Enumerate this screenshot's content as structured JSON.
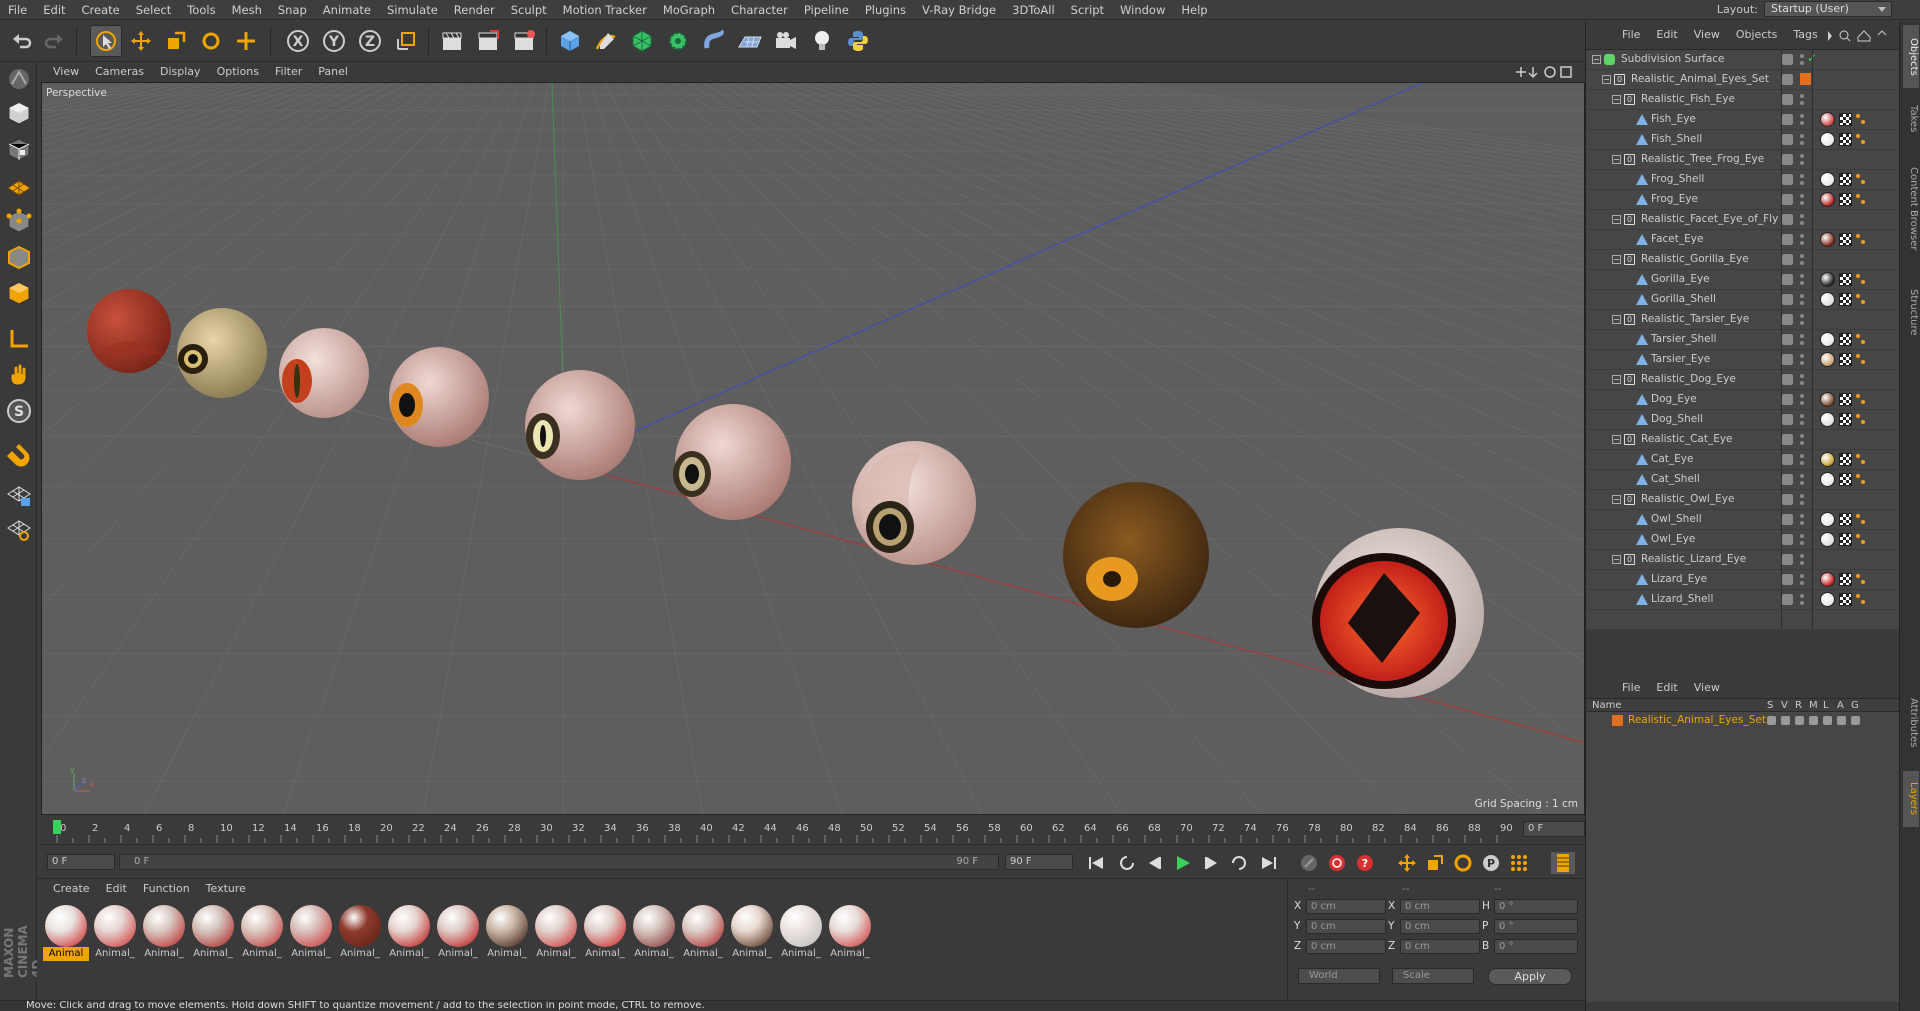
{
  "menubar": {
    "items": [
      "File",
      "Edit",
      "Create",
      "Select",
      "Tools",
      "Mesh",
      "Snap",
      "Animate",
      "Simulate",
      "Render",
      "Sculpt",
      "Motion Tracker",
      "MoGraph",
      "Character",
      "Pipeline",
      "Plugins",
      "V-Ray Bridge",
      "3DToAll",
      "Script",
      "Window",
      "Help"
    ],
    "layout_label": "Layout:",
    "layout_value": "Startup (User)"
  },
  "viewport": {
    "menu": [
      "View",
      "Cameras",
      "Display",
      "Options",
      "Filter",
      "Panel"
    ],
    "label": "Perspective",
    "grid_spacing": "Grid Spacing : 1 cm"
  },
  "timeline": {
    "ticks": [
      "0",
      "2",
      "4",
      "6",
      "8",
      "10",
      "12",
      "14",
      "16",
      "18",
      "20",
      "22",
      "24",
      "26",
      "28",
      "30",
      "32",
      "34",
      "36",
      "38",
      "40",
      "42",
      "44",
      "46",
      "48",
      "50",
      "52",
      "54",
      "56",
      "58",
      "60",
      "62",
      "64",
      "66",
      "68",
      "70",
      "72",
      "74",
      "76",
      "78",
      "80",
      "82",
      "84",
      "86",
      "88",
      "90"
    ],
    "current_frame": "0 F"
  },
  "transport": {
    "start_frame": "0 F",
    "slider_start": "0 F",
    "slider_end": "90 F",
    "end_frame": "90 F"
  },
  "materials": {
    "menu": [
      "Create",
      "Edit",
      "Function",
      "Texture"
    ],
    "items": [
      {
        "label": "Animal",
        "color": "#e9e3e0",
        "accent": "#c22"
      },
      {
        "label": "Animal_",
        "color": "#e6d6d2",
        "accent": "#c33"
      },
      {
        "label": "Animal_",
        "color": "#d8c8c0",
        "accent": "#b22"
      },
      {
        "label": "Animal_",
        "color": "#d5c5bd",
        "accent": "#a22"
      },
      {
        "label": "Animal_",
        "color": "#dcc8c0",
        "accent": "#b33"
      },
      {
        "label": "Animal_",
        "color": "#d9c1bc",
        "accent": "#c33"
      },
      {
        "label": "Animal_",
        "color": "#8e3a2a",
        "accent": "#5c2014"
      },
      {
        "label": "Animal_",
        "color": "#e5d5cf",
        "accent": "#b11"
      },
      {
        "label": "Animal_",
        "color": "#dfcdc8",
        "accent": "#b11"
      },
      {
        "label": "Animal_",
        "color": "#ccb8a8",
        "accent": "#3a1a10"
      },
      {
        "label": "Animal_",
        "color": "#e1d2cc",
        "accent": "#c33"
      },
      {
        "label": "Animal_",
        "color": "#e0d1cb",
        "accent": "#c22"
      },
      {
        "label": "Animal_",
        "color": "#d6c6c0",
        "accent": "#833"
      },
      {
        "label": "Animal_",
        "color": "#dcccc6",
        "accent": "#a22"
      },
      {
        "label": "Animal_",
        "color": "#e8d8d0",
        "accent": "#4a2510"
      },
      {
        "label": "Animal_",
        "color": "#ece4e0",
        "accent": "#bbb"
      },
      {
        "label": "Animal_",
        "color": "#e7ddd8",
        "accent": "#c33"
      }
    ]
  },
  "coordinates": {
    "header_pos": "--",
    "header_size": "--",
    "header_rot": "--",
    "rows": [
      {
        "pos_label": "X",
        "pos_value": "0 cm",
        "size_label": "X",
        "size_value": "0 cm",
        "rot_label": "H",
        "rot_value": "0 °"
      },
      {
        "pos_label": "Y",
        "pos_value": "0 cm",
        "size_label": "Y",
        "size_value": "0 cm",
        "rot_label": "P",
        "rot_value": "0 °"
      },
      {
        "pos_label": "Z",
        "pos_value": "0 cm",
        "size_label": "Z",
        "size_value": "0 cm",
        "rot_label": "B",
        "rot_value": "0 °"
      }
    ],
    "mode_world": "World",
    "mode_scale": "Scale",
    "apply": "Apply"
  },
  "status": "Move: Click and drag to move elements. Hold down SHIFT to quantize movement / add to the selection in point mode, CTRL to remove.",
  "objects": {
    "menu": [
      "File",
      "Edit",
      "View",
      "Objects",
      "Tags"
    ],
    "items": [
      {
        "name": "Subdivision Surface",
        "depth": 0,
        "kind": "subd"
      },
      {
        "name": "Realistic_Animal_Eyes_Set",
        "depth": 1,
        "kind": "null"
      },
      {
        "name": "Realistic_Fish_Eye",
        "depth": 2,
        "kind": "null"
      },
      {
        "name": "Fish_Eye",
        "depth": 3,
        "kind": "poly",
        "tagcolor": "#c44"
      },
      {
        "name": "Fish_Shell",
        "depth": 3,
        "kind": "poly",
        "tagcolor": "#e8e8e8"
      },
      {
        "name": "Realistic_Tree_Frog_Eye",
        "depth": 2,
        "kind": "null"
      },
      {
        "name": "Frog_Shell",
        "depth": 3,
        "kind": "poly",
        "tagcolor": "#e8e8e8"
      },
      {
        "name": "Frog_Eye",
        "depth": 3,
        "kind": "poly",
        "tagcolor": "#b22"
      },
      {
        "name": "Realistic_Facet_Eye_of_Fly",
        "depth": 2,
        "kind": "null"
      },
      {
        "name": "Facet_Eye",
        "depth": 3,
        "kind": "poly",
        "tagcolor": "#8a2a1a"
      },
      {
        "name": "Realistic_Gorilla_Eye",
        "depth": 2,
        "kind": "null"
      },
      {
        "name": "Gorilla_Eye",
        "depth": 3,
        "kind": "poly",
        "tagcolor": "#222"
      },
      {
        "name": "Gorilla_Shell",
        "depth": 3,
        "kind": "poly",
        "tagcolor": "#ddd"
      },
      {
        "name": "Realistic_Tarsier_Eye",
        "depth": 2,
        "kind": "null"
      },
      {
        "name": "Tarsier_Shell",
        "depth": 3,
        "kind": "poly",
        "tagcolor": "#e8e8e8"
      },
      {
        "name": "Tarsier_Eye",
        "depth": 3,
        "kind": "poly",
        "tagcolor": "#c9a070"
      },
      {
        "name": "Realistic_Dog_Eye",
        "depth": 2,
        "kind": "null"
      },
      {
        "name": "Dog_Eye",
        "depth": 3,
        "kind": "poly",
        "tagcolor": "#7a4a2a"
      },
      {
        "name": "Dog_Shell",
        "depth": 3,
        "kind": "poly",
        "tagcolor": "#e0e0e0"
      },
      {
        "name": "Realistic_Cat_Eye",
        "depth": 2,
        "kind": "null"
      },
      {
        "name": "Cat_Eye",
        "depth": 3,
        "kind": "poly",
        "tagcolor": "#c9a030"
      },
      {
        "name": "Cat_Shell",
        "depth": 3,
        "kind": "poly",
        "tagcolor": "#e8e8e8"
      },
      {
        "name": "Realistic_Owl_Eye",
        "depth": 2,
        "kind": "null"
      },
      {
        "name": "Owl_Shell",
        "depth": 3,
        "kind": "poly",
        "tagcolor": "#e8e8e8"
      },
      {
        "name": "Owl_Eye",
        "depth": 3,
        "kind": "poly",
        "tagcolor": "#ddd"
      },
      {
        "name": "Realistic_Lizard_Eye",
        "depth": 2,
        "kind": "null"
      },
      {
        "name": "Lizard_Eye",
        "depth": 3,
        "kind": "poly",
        "tagcolor": "#c22"
      },
      {
        "name": "Lizard_Shell",
        "depth": 3,
        "kind": "poly",
        "tagcolor": "#e8e8e8"
      }
    ]
  },
  "layers": {
    "menu": [
      "File",
      "Edit",
      "View"
    ],
    "columns": [
      "Name",
      "S",
      "V",
      "R",
      "M",
      "L",
      "A",
      "G"
    ],
    "items": [
      {
        "name": "Realistic_Animal_Eyes_Set",
        "color": "#e07020"
      }
    ]
  },
  "sidetabs": [
    "Objects",
    "Takes",
    "Content Browser",
    "Structure"
  ],
  "sidetabs_bottom": [
    "Attributes",
    "Layers"
  ]
}
